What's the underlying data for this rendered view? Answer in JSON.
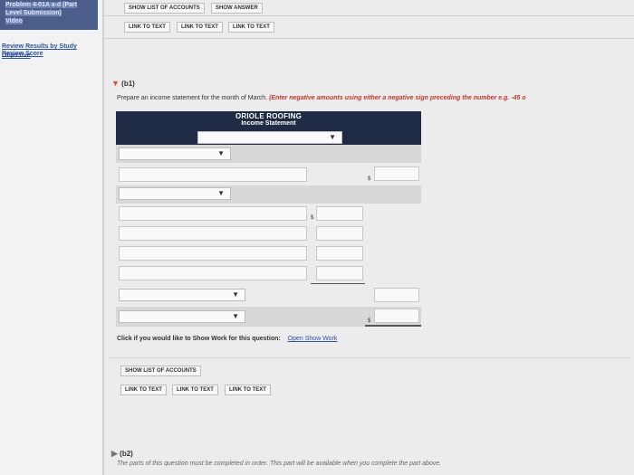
{
  "sidebar": {
    "title_line1": "Problem 4-01A a-d (Part",
    "title_line2": "Level Submission)",
    "title_line3": "Video",
    "review_score": "Review Score",
    "review_results": "Review Results by Study",
    "objective": "Objective"
  },
  "top_toolbar": {
    "show_list": "SHOW LIST OF ACCOUNTS",
    "show_answer": "SHOW ANSWER",
    "link1": "LINK TO TEXT",
    "link2": "LINK TO TEXT",
    "link3": "LINK TO TEXT"
  },
  "part_b1": {
    "label": "(b1)",
    "prompt": "Prepare an income statement for the month of March.",
    "prompt_note": "(Enter negative amounts using either a negative sign preceding the number e.g. -45 o"
  },
  "statement": {
    "company": "ORIOLE ROOFING",
    "title": "Income Statement",
    "currency": "$"
  },
  "show_work": {
    "question": "Click if you would like to Show Work for this question:",
    "link": "Open Show Work"
  },
  "bottom_toolbar": {
    "show_list": "SHOW LIST OF ACCOUNTS",
    "link1": "LINK TO TEXT",
    "link2": "LINK TO TEXT",
    "link3": "LINK TO TEXT"
  },
  "part_b2": {
    "label": "(b2)",
    "note": "The parts of this question must be completed in order. This part will be available when you complete the part above."
  },
  "colors": {
    "header_navy": "#1f2a44",
    "link_blue": "#2c52a8",
    "accent_red": "#c0392b"
  }
}
